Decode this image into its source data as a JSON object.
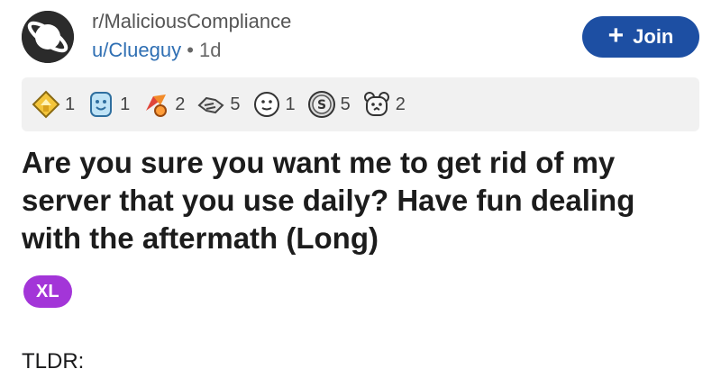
{
  "post": {
    "subreddit": "r/MaliciousCompliance",
    "author": "u/Clueguy",
    "separator": "•",
    "age": "1d",
    "join_label": "Join",
    "join_icon": "plus-icon",
    "title": "Are you sure you want me to get rid of my server that you use daily? Have fun dealing with the aftermath (Long)",
    "flair": "XL",
    "body_start": "TLDR:"
  },
  "awards": [
    {
      "icon": "helpful-award-icon",
      "count": "1"
    },
    {
      "icon": "wholesome-award-icon",
      "count": "1"
    },
    {
      "icon": "rocket-like-award-icon",
      "count": "2"
    },
    {
      "icon": "handshake-award-icon",
      "count": "5"
    },
    {
      "icon": "face-award-icon",
      "count": "1"
    },
    {
      "icon": "silver-coin-award-icon",
      "count": "5"
    },
    {
      "icon": "bear-award-icon",
      "count": "2"
    }
  ],
  "colors": {
    "join_button": "#1d4fa3",
    "flair_bg": "#a335d8",
    "author_link": "#2f6fb3",
    "awards_bar": "#f1f1f1"
  }
}
